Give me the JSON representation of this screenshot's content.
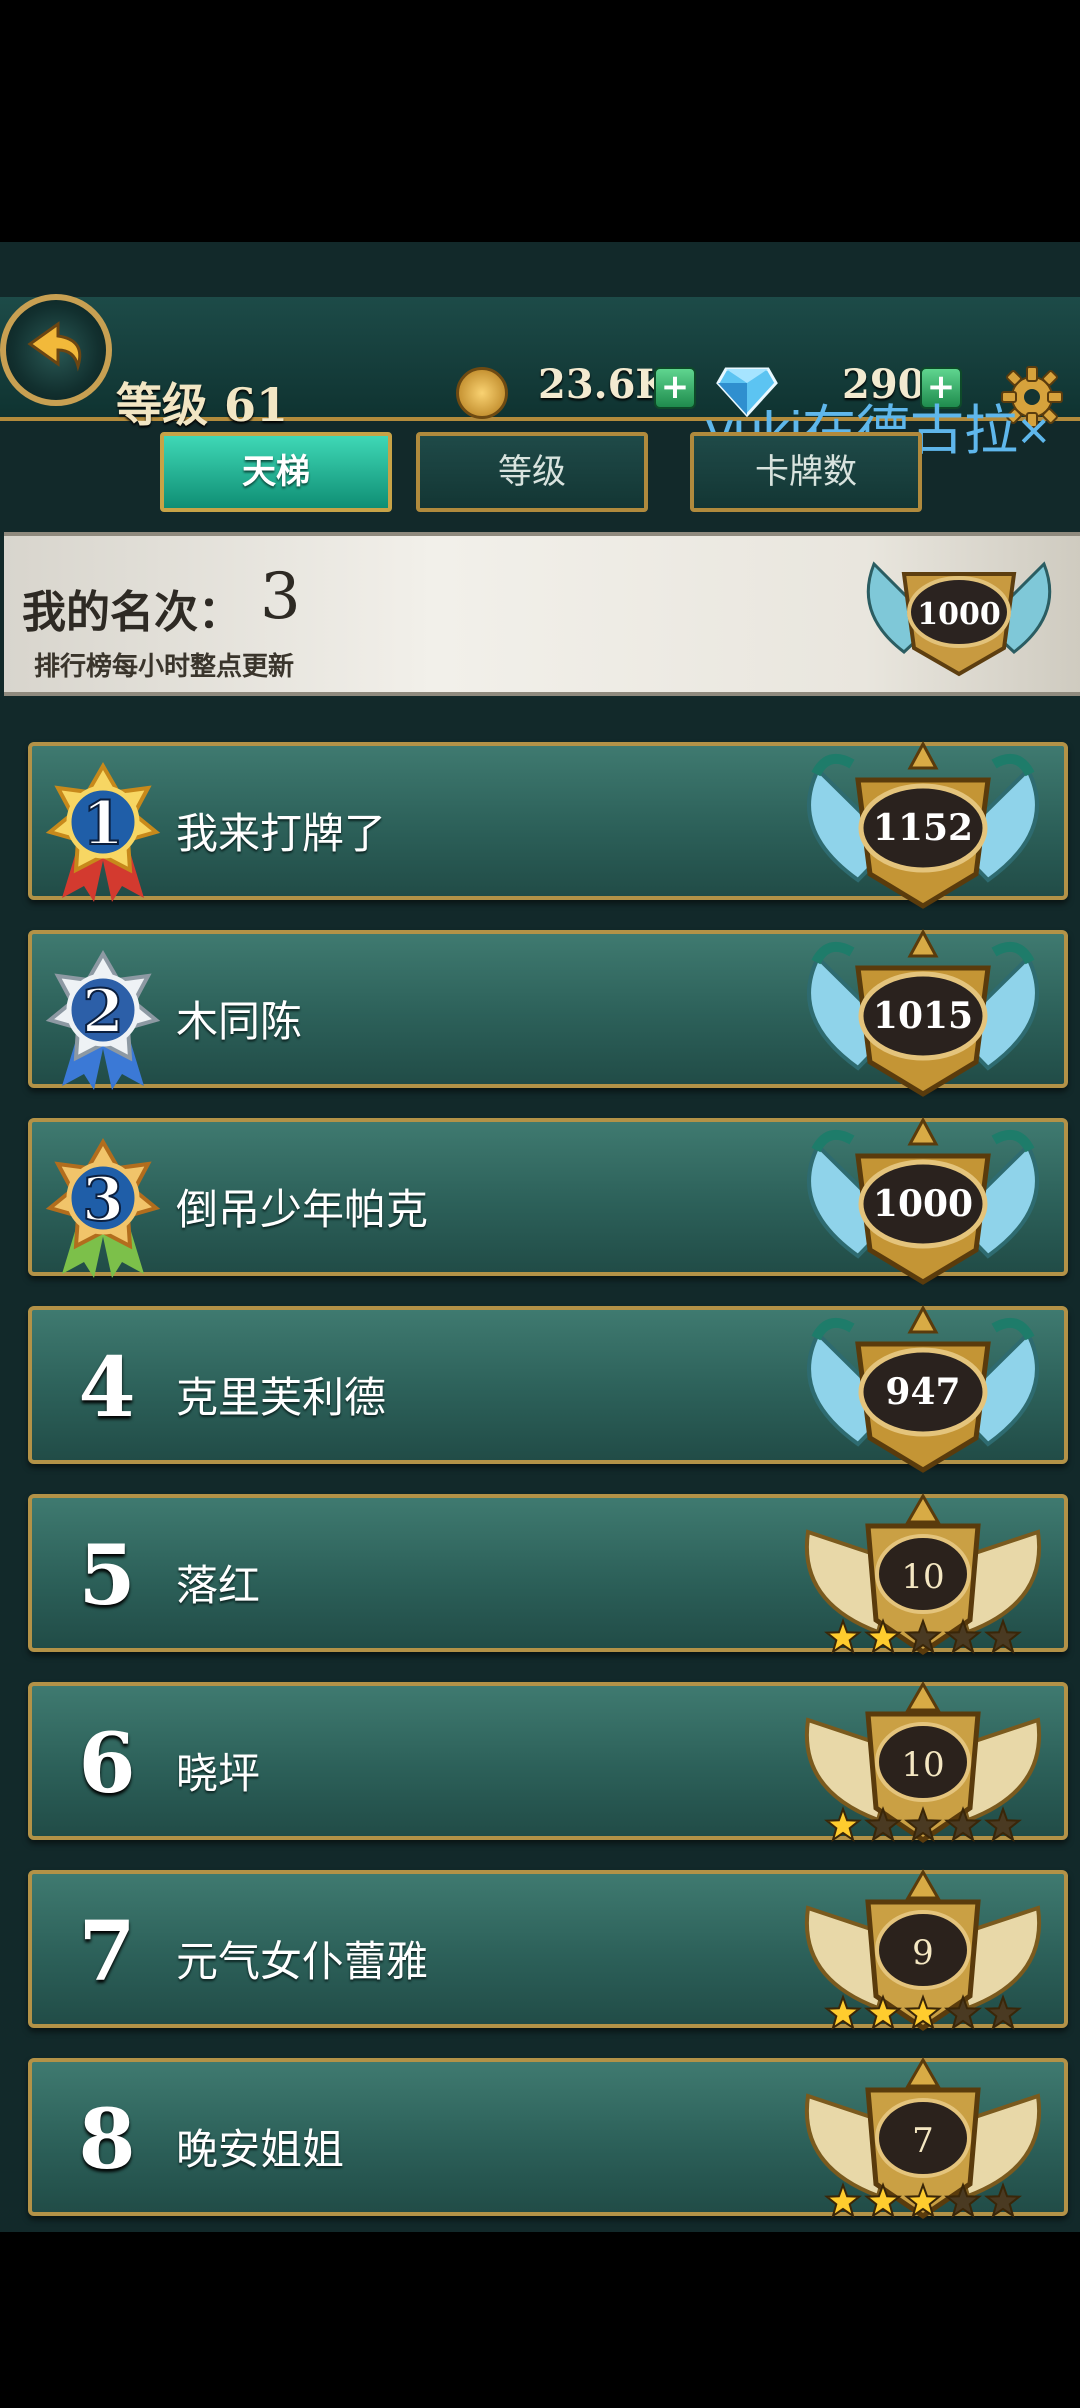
{
  "header": {
    "level_label": "等级 61",
    "coins": "23.6K",
    "gems": "290",
    "plus": "+"
  },
  "overlay_text": "yuki在德古拉×",
  "tabs": [
    {
      "label": "天梯",
      "active": true
    },
    {
      "label": "等级",
      "active": false
    },
    {
      "label": "卡牌数",
      "active": false
    }
  ],
  "banner": {
    "rank_label": "我的名次：",
    "rank_value": "3",
    "note": "排行榜每小时整点更新",
    "score": "1000"
  },
  "rows": [
    {
      "rank": "1",
      "name": "我来打牌了",
      "score": "1152",
      "badge": "winged-shield",
      "stars": 0,
      "medal": "gold"
    },
    {
      "rank": "2",
      "name": "木同陈",
      "score": "1015",
      "badge": "winged-shield",
      "stars": 0,
      "medal": "silver"
    },
    {
      "rank": "3",
      "name": "倒吊少年帕克",
      "score": "1000",
      "badge": "winged-shield",
      "stars": 0,
      "medal": "bronze"
    },
    {
      "rank": "4",
      "name": "克里芙利德",
      "score": "947",
      "badge": "winged-shield",
      "stars": 0,
      "medal": ""
    },
    {
      "rank": "5",
      "name": "落红",
      "score": "10",
      "badge": "gold-wings",
      "stars": 2,
      "medal": ""
    },
    {
      "rank": "6",
      "name": "晓坪",
      "score": "10",
      "badge": "gold-wings",
      "stars": 1,
      "medal": ""
    },
    {
      "rank": "7",
      "name": "元气女仆蕾雅",
      "score": "9",
      "badge": "gold-wings",
      "stars": 3,
      "medal": ""
    },
    {
      "rank": "8",
      "name": "晚安姐姐",
      "score": "7",
      "badge": "gold-wings",
      "stars": 3,
      "medal": ""
    }
  ],
  "colors": {
    "accent_gold": "#c8a052",
    "row_teal": "#2c6059",
    "tab_active": "#1fb593",
    "overlay_blue": "#5fb7ec"
  }
}
